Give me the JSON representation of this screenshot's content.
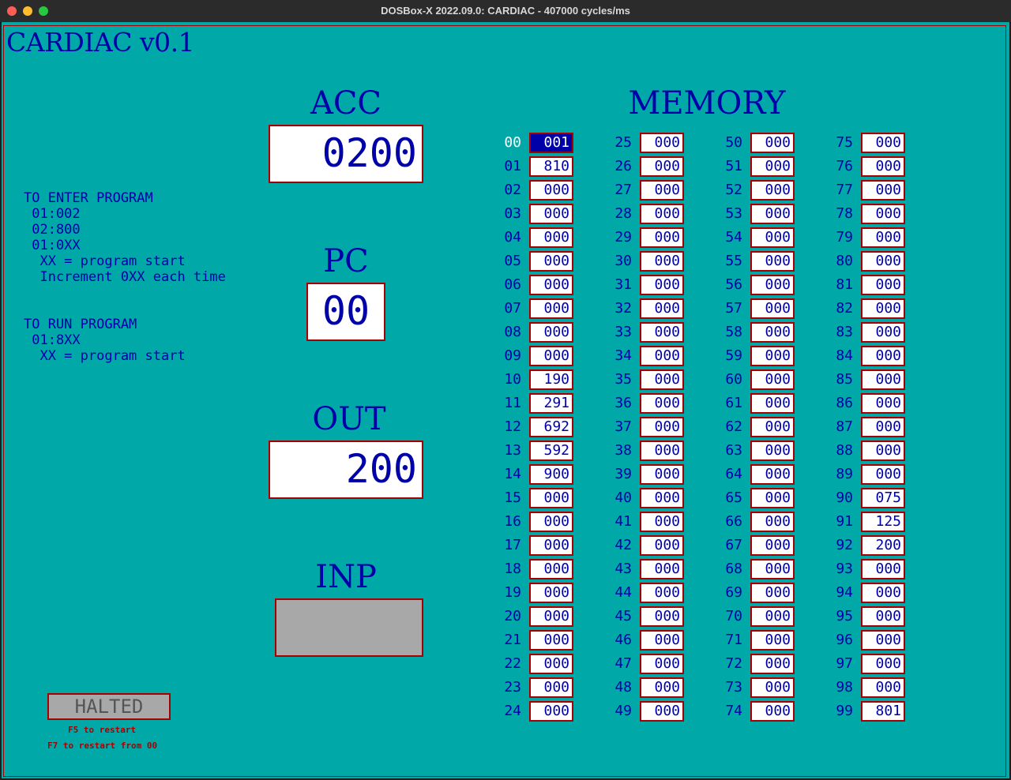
{
  "window": {
    "title": "DOSBox-X 2022.09.0: CARDIAC - 407000 cycles/ms"
  },
  "app": {
    "title": "CARDIAC v0.1"
  },
  "registers": {
    "acc": {
      "label": "ACC",
      "value": "0200"
    },
    "pc": {
      "label": "PC",
      "value": "00"
    },
    "out": {
      "label": "OUT",
      "value": "200"
    },
    "inp": {
      "label": "INP",
      "value": ""
    }
  },
  "instructions": {
    "enter_title": "TO ENTER PROGRAM",
    "enter_lines": [
      " 01:002",
      " 02:800",
      " 01:0XX",
      "  XX = program start",
      "  Increment 0XX each time"
    ],
    "run_title": "TO RUN PROGRAM",
    "run_lines": [
      " 01:8XX",
      "  XX = program start"
    ]
  },
  "memory": {
    "title": "MEMORY",
    "selected": "00",
    "cells": [
      {
        "addr": "00",
        "val": "001"
      },
      {
        "addr": "01",
        "val": "810"
      },
      {
        "addr": "02",
        "val": "000"
      },
      {
        "addr": "03",
        "val": "000"
      },
      {
        "addr": "04",
        "val": "000"
      },
      {
        "addr": "05",
        "val": "000"
      },
      {
        "addr": "06",
        "val": "000"
      },
      {
        "addr": "07",
        "val": "000"
      },
      {
        "addr": "08",
        "val": "000"
      },
      {
        "addr": "09",
        "val": "000"
      },
      {
        "addr": "10",
        "val": "190"
      },
      {
        "addr": "11",
        "val": "291"
      },
      {
        "addr": "12",
        "val": "692"
      },
      {
        "addr": "13",
        "val": "592"
      },
      {
        "addr": "14",
        "val": "900"
      },
      {
        "addr": "15",
        "val": "000"
      },
      {
        "addr": "16",
        "val": "000"
      },
      {
        "addr": "17",
        "val": "000"
      },
      {
        "addr": "18",
        "val": "000"
      },
      {
        "addr": "19",
        "val": "000"
      },
      {
        "addr": "20",
        "val": "000"
      },
      {
        "addr": "21",
        "val": "000"
      },
      {
        "addr": "22",
        "val": "000"
      },
      {
        "addr": "23",
        "val": "000"
      },
      {
        "addr": "24",
        "val": "000"
      },
      {
        "addr": "25",
        "val": "000"
      },
      {
        "addr": "26",
        "val": "000"
      },
      {
        "addr": "27",
        "val": "000"
      },
      {
        "addr": "28",
        "val": "000"
      },
      {
        "addr": "29",
        "val": "000"
      },
      {
        "addr": "30",
        "val": "000"
      },
      {
        "addr": "31",
        "val": "000"
      },
      {
        "addr": "32",
        "val": "000"
      },
      {
        "addr": "33",
        "val": "000"
      },
      {
        "addr": "34",
        "val": "000"
      },
      {
        "addr": "35",
        "val": "000"
      },
      {
        "addr": "36",
        "val": "000"
      },
      {
        "addr": "37",
        "val": "000"
      },
      {
        "addr": "38",
        "val": "000"
      },
      {
        "addr": "39",
        "val": "000"
      },
      {
        "addr": "40",
        "val": "000"
      },
      {
        "addr": "41",
        "val": "000"
      },
      {
        "addr": "42",
        "val": "000"
      },
      {
        "addr": "43",
        "val": "000"
      },
      {
        "addr": "44",
        "val": "000"
      },
      {
        "addr": "45",
        "val": "000"
      },
      {
        "addr": "46",
        "val": "000"
      },
      {
        "addr": "47",
        "val": "000"
      },
      {
        "addr": "48",
        "val": "000"
      },
      {
        "addr": "49",
        "val": "000"
      },
      {
        "addr": "50",
        "val": "000"
      },
      {
        "addr": "51",
        "val": "000"
      },
      {
        "addr": "52",
        "val": "000"
      },
      {
        "addr": "53",
        "val": "000"
      },
      {
        "addr": "54",
        "val": "000"
      },
      {
        "addr": "55",
        "val": "000"
      },
      {
        "addr": "56",
        "val": "000"
      },
      {
        "addr": "57",
        "val": "000"
      },
      {
        "addr": "58",
        "val": "000"
      },
      {
        "addr": "59",
        "val": "000"
      },
      {
        "addr": "60",
        "val": "000"
      },
      {
        "addr": "61",
        "val": "000"
      },
      {
        "addr": "62",
        "val": "000"
      },
      {
        "addr": "63",
        "val": "000"
      },
      {
        "addr": "64",
        "val": "000"
      },
      {
        "addr": "65",
        "val": "000"
      },
      {
        "addr": "66",
        "val": "000"
      },
      {
        "addr": "67",
        "val": "000"
      },
      {
        "addr": "68",
        "val": "000"
      },
      {
        "addr": "69",
        "val": "000"
      },
      {
        "addr": "70",
        "val": "000"
      },
      {
        "addr": "71",
        "val": "000"
      },
      {
        "addr": "72",
        "val": "000"
      },
      {
        "addr": "73",
        "val": "000"
      },
      {
        "addr": "74",
        "val": "000"
      },
      {
        "addr": "75",
        "val": "000"
      },
      {
        "addr": "76",
        "val": "000"
      },
      {
        "addr": "77",
        "val": "000"
      },
      {
        "addr": "78",
        "val": "000"
      },
      {
        "addr": "79",
        "val": "000"
      },
      {
        "addr": "80",
        "val": "000"
      },
      {
        "addr": "81",
        "val": "000"
      },
      {
        "addr": "82",
        "val": "000"
      },
      {
        "addr": "83",
        "val": "000"
      },
      {
        "addr": "84",
        "val": "000"
      },
      {
        "addr": "85",
        "val": "000"
      },
      {
        "addr": "86",
        "val": "000"
      },
      {
        "addr": "87",
        "val": "000"
      },
      {
        "addr": "88",
        "val": "000"
      },
      {
        "addr": "89",
        "val": "000"
      },
      {
        "addr": "90",
        "val": "075"
      },
      {
        "addr": "91",
        "val": "125"
      },
      {
        "addr": "92",
        "val": "200"
      },
      {
        "addr": "93",
        "val": "000"
      },
      {
        "addr": "94",
        "val": "000"
      },
      {
        "addr": "95",
        "val": "000"
      },
      {
        "addr": "96",
        "val": "000"
      },
      {
        "addr": "97",
        "val": "000"
      },
      {
        "addr": "98",
        "val": "000"
      },
      {
        "addr": "99",
        "val": "801"
      }
    ]
  },
  "status": {
    "state": "HALTED",
    "hint_restart": "F5 to restart",
    "hint_restart_from": "F7 to restart from 00"
  },
  "colors": {
    "background": "#00a8a8",
    "text": "#0000a8",
    "border": "#a80000",
    "selected": "#0000a8"
  }
}
